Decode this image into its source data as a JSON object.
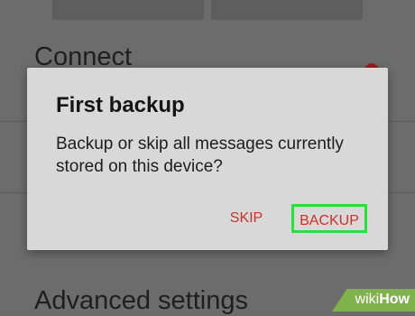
{
  "background": {
    "sections": {
      "connect": "Connect",
      "advanced_settings": "Advanced settings"
    }
  },
  "dialog": {
    "title": "First backup",
    "message": "Backup or skip all messages currently stored on this device?",
    "buttons": {
      "skip": "SKIP",
      "backup": "BACKUP"
    },
    "button_color": "#c8322a",
    "highlight_color": "#26e13a"
  },
  "watermark": {
    "wiki": "wiki",
    "how": "How"
  }
}
